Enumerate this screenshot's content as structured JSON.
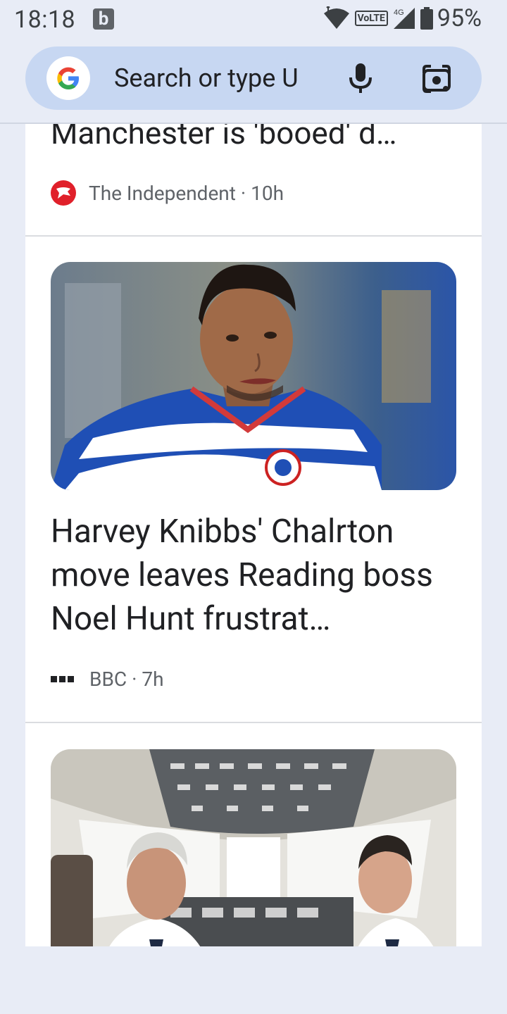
{
  "status_bar": {
    "time": "18:18",
    "notification_icon": "b",
    "network_label": "VoLTE",
    "signal_label": "4G",
    "battery": "95%"
  },
  "search": {
    "placeholder": "Search or type U",
    "icons": [
      "google-logo",
      "mic-icon",
      "lens-icon"
    ]
  },
  "feed": {
    "items": [
      {
        "headline": "Manchester is 'booed' d…",
        "source": "The Independent",
        "age": "10h",
        "source_icon": "independent-eagle-icon"
      },
      {
        "headline": "Harvey Knibbs' Chalrton move leaves Reading boss Noel Hunt frustrat…",
        "source": "BBC",
        "age": "7h",
        "source_icon": "bbc-logo-icon",
        "image": "footballer-photo"
      },
      {
        "image": "cockpit-pilots-photo"
      }
    ]
  },
  "colors": {
    "background": "#e8ecf6",
    "search_bar": "#c7d7f2",
    "card": "#ffffff",
    "independent_red": "#e0202a"
  }
}
